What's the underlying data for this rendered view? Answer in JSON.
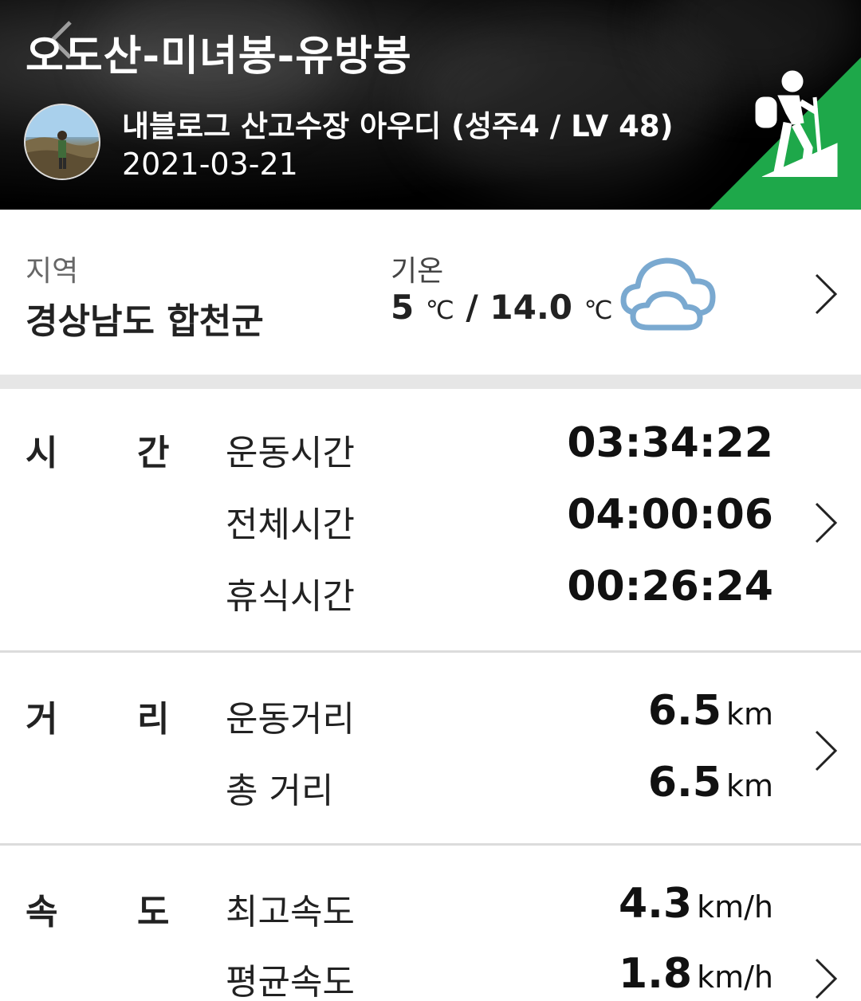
{
  "header": {
    "title": "오도산-미녀봉-유방봉",
    "user_name": "내블로그 산고수장 아우디 (성주4 / LV 48)",
    "date": "2021-03-21",
    "accent_color": "#1ea84a"
  },
  "region": {
    "label": "지역",
    "value": "경상남도 합천군"
  },
  "temperature": {
    "label": "기온",
    "low": "5",
    "high": "14.0",
    "separator": " / ",
    "unit": "℃",
    "weather_icon": "cloud-icon"
  },
  "time": {
    "category": [
      "시",
      "간"
    ],
    "rows": [
      {
        "label": "운동시간",
        "value": "03:34:22"
      },
      {
        "label": "전체시간",
        "value": "04:00:06"
      },
      {
        "label": "휴식시간",
        "value": "00:26:24"
      }
    ]
  },
  "distance": {
    "category": [
      "거",
      "리"
    ],
    "rows": [
      {
        "label": "운동거리",
        "value": "6.5",
        "unit": "km"
      },
      {
        "label": "총 거리",
        "value": "6.5",
        "unit": "km"
      }
    ]
  },
  "speed": {
    "category": [
      "속",
      "도"
    ],
    "rows": [
      {
        "label": "최고속도",
        "value": "4.3",
        "unit": "km/h"
      },
      {
        "label": "평균속도",
        "value": "1.8",
        "unit": "km/h"
      }
    ]
  }
}
